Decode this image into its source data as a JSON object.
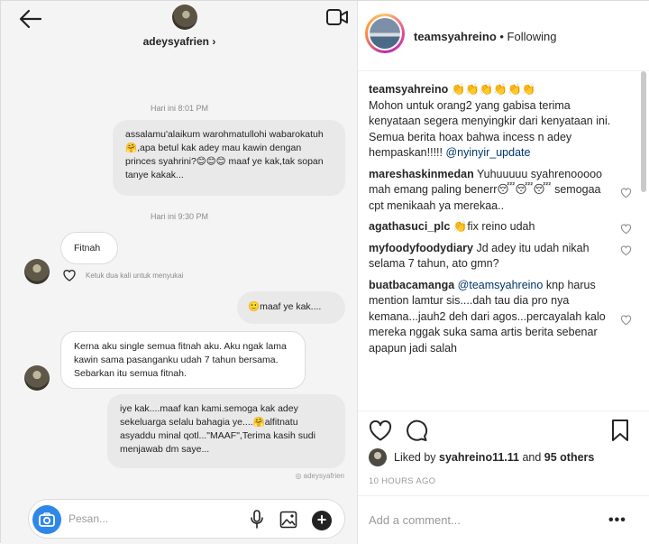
{
  "dm": {
    "contact_name": "adeysyafrien",
    "contact_chevron": "›",
    "timestamp_1": "Hari ini 8:01 PM",
    "timestamp_2": "Hari ini 9:30 PM",
    "messages": [
      {
        "text": "assalamu'alaikum warohmatullohi wabarokatuh🤗,apa betul kak adey mau kawin dengan princes syahrini?😊😊😊 maaf ye kak,tak sopan tanye kakak..."
      },
      {
        "text": "Fitnah"
      },
      {
        "text": "🙂maaf ye kak...."
      },
      {
        "text": "Kerna aku single semua fitnah aku. Aku ngak lama kawin sama pasanganku udah 7 tahun bersama. Sebarkan itu semua fitnah."
      },
      {
        "text": "iye kak....maaf kan kami.semoga kak adey sekeluarga selalu bahagia ye....🤗alfitnatu asyaddu minal qotl...\"MAAF\",Terima kasih sudi menjawab dm saye..."
      }
    ],
    "double_tap_hint": "Ketuk dua kali untuk menyukai",
    "watermark": "adeysyafrien",
    "composer_placeholder": "Pesan..."
  },
  "post": {
    "username": "teamsyahreino",
    "follow_state": "• Following",
    "comments": [
      {
        "user": "teamsyahreino",
        "lines": [
          "👏👏👏👏👏👏",
          "Mohon untuk orang2 yang gabisa terima kenyataan segera menyingkir dari kenyataan ini.",
          "Semua berita hoax bahwa incess n adey hempaskan!!!!! "
        ],
        "mention": "@nyinyir_update"
      },
      {
        "user": "mareshaskinmedan",
        "text": "Yuhuuuuu syahrenooooo mah emang paling benerr😴😴😴 semogaa cpt menikaah ya merekaa.."
      },
      {
        "user": "agathasuci_plc",
        "text": "👏fix reino udah"
      },
      {
        "user": "myfoodyfoodydiary",
        "text": "Jd adey itu udah nikah selama 7 tahun, ato gmn?"
      },
      {
        "user": "buatbacamanga",
        "mention": "@teamsyahreino",
        "text": " knp harus mention lamtur sis....dah tau dia pro nya kemana...jauh2 deh dari agos...percayalah kalo mereka nggak suka sama artis berita sebenar apapun jadi salah"
      }
    ],
    "liked_by_prefix": "Liked by ",
    "liked_by_user": "syahreino11.11",
    "liked_by_and": " and ",
    "liked_by_others": "95 others",
    "time_ago": "10 HOURS AGO",
    "add_comment_placeholder": "Add a comment...",
    "more_label": "•••"
  }
}
